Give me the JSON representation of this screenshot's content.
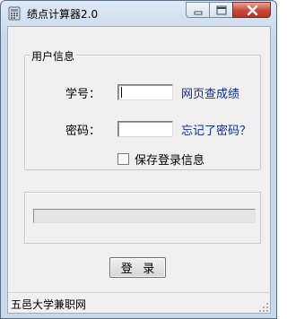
{
  "window": {
    "title": "绩点计算器2.0",
    "icon": "calculator-app-icon"
  },
  "caption": {
    "minimize_icon": "minimize-icon",
    "maximize_icon": "maximize-icon",
    "close_icon": "close-icon"
  },
  "user_group": {
    "label": "用户信息",
    "student_id_label": "学号：",
    "student_id_value": "",
    "web_query_link": "网页查成绩",
    "password_label": "密码：",
    "password_value": "",
    "forgot_password_link": "忘记了密码？",
    "remember_checkbox_label": "保存登录信息",
    "remember_checked": false
  },
  "progress": {
    "value": 0
  },
  "login_button": "登 录",
  "statusbar": {
    "text": "五邑大学兼职网"
  },
  "colors": {
    "link": "#0a2d9c",
    "client_bg": "#f0f0f0",
    "close_button": "#c7493a"
  }
}
